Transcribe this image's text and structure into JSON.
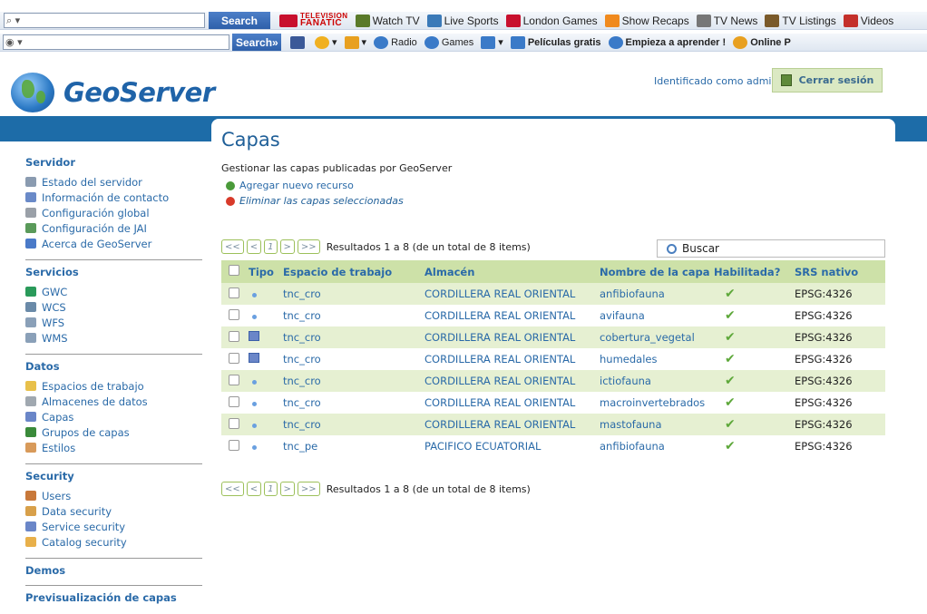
{
  "toolbar1": {
    "search_label": "Search",
    "search_glyph": "⌕ ▾",
    "fanatic_line1": "TELEVISION",
    "fanatic_line2": "FANATIC",
    "items": [
      {
        "label": "Watch TV",
        "icon": "tv-icon",
        "color": "#5a7a2a"
      },
      {
        "label": "Live Sports",
        "icon": "sports-icon",
        "color": "#3b7ab8"
      },
      {
        "label": "London Games",
        "icon": "uk-flag-icon",
        "color": "#c8102e"
      },
      {
        "label": "Show Recaps",
        "icon": "chat-icon",
        "color": "#f08a1e"
      },
      {
        "label": "TV News",
        "icon": "news-icon",
        "color": "#777777"
      },
      {
        "label": "TV Listings",
        "icon": "listings-icon",
        "color": "#7a5a2a"
      },
      {
        "label": "Videos",
        "icon": "youtube-icon",
        "color": "#c4302b"
      }
    ]
  },
  "toolbar2": {
    "search_glyph": "◉ ▾",
    "search_label": "Search»",
    "items": [
      {
        "label": "",
        "icon": "facebook-icon",
        "color": "#3b5998",
        "bold": false
      },
      {
        "label": "▾",
        "icon": "star-icon",
        "color": "#f0b020",
        "bold": false
      },
      {
        "label": "▾",
        "icon": "people-icon",
        "color": "#e8a020",
        "bold": false
      },
      {
        "label": "Radio",
        "icon": "radio-icon",
        "color": "#3a7ac8",
        "bold": false
      },
      {
        "label": "Games",
        "icon": "games-icon",
        "color": "#3a7ac8",
        "bold": false
      },
      {
        "label": "▾",
        "icon": "calendar-icon",
        "color": "#3a7ac8",
        "bold": false
      },
      {
        "label": "Películas gratis",
        "icon": "tv-blue-icon",
        "color": "#3a7ac8",
        "bold": true
      },
      {
        "label": "Empieza a aprender !",
        "icon": "globe-icon",
        "color": "#3a7ac8",
        "bold": true
      },
      {
        "label": "Online P",
        "icon": "smiley-icon",
        "color": "#e8a020",
        "bold": true
      }
    ]
  },
  "header": {
    "logo_text": "GeoServer",
    "identified_as": "Identificado como admin.",
    "logout_label": "Cerrar sesión"
  },
  "sidebar": {
    "sections": [
      {
        "title": "Servidor",
        "items": [
          {
            "label": "Estado del servidor",
            "color": "#8a9bb0"
          },
          {
            "label": "Información de contacto",
            "color": "#6a8ac8"
          },
          {
            "label": "Configuración global",
            "color": "#9aa0a8"
          },
          {
            "label": "Configuración de JAI",
            "color": "#5a9a5a"
          },
          {
            "label": "Acerca de GeoServer",
            "color": "#4a7ac8"
          }
        ]
      },
      {
        "title": "Servicios",
        "items": [
          {
            "label": "GWC",
            "color": "#2a9a5a"
          },
          {
            "label": "WCS",
            "color": "#6a8aa8"
          },
          {
            "label": "WFS",
            "color": "#8aa0b8"
          },
          {
            "label": "WMS",
            "color": "#8aa0b8"
          }
        ]
      },
      {
        "title": "Datos",
        "items": [
          {
            "label": "Espacios de trabajo",
            "color": "#e8c04a"
          },
          {
            "label": "Almacenes de datos",
            "color": "#a0a8b0"
          },
          {
            "label": "Capas",
            "color": "#6a86c8"
          },
          {
            "label": "Grupos de capas",
            "color": "#3a8a3a"
          },
          {
            "label": "Estilos",
            "color": "#d89a5a"
          }
        ]
      },
      {
        "title": "Security",
        "items": [
          {
            "label": "Users",
            "color": "#c8783a"
          },
          {
            "label": "Data security",
            "color": "#d8a04a"
          },
          {
            "label": "Service security",
            "color": "#6a86c8"
          },
          {
            "label": "Catalog security",
            "color": "#e8b04a"
          }
        ]
      },
      {
        "title": "Demos",
        "items": []
      },
      {
        "title": "Previsualización de capas",
        "items": []
      }
    ]
  },
  "page": {
    "title": "Capas",
    "description": "Gestionar las capas publicadas por GeoServer",
    "add_label": "Agregar nuevo recurso",
    "remove_label": "Eliminar las capas seleccionadas",
    "pager": {
      "first": "<<",
      "prev": "<",
      "page": "1",
      "next": ">",
      "last": ">>"
    },
    "results_text": "Resultados 1 a 8 (de un total de 8 items)",
    "search_placeholder": "Buscar"
  },
  "table": {
    "headers": [
      "Tipo",
      "Espacio de trabajo",
      "Almacén",
      "Nombre de la capa",
      "Habilitada?",
      "SRS nativo"
    ],
    "rows": [
      {
        "type": "point",
        "workspace": "tnc_cro",
        "store": "CORDILLERA REAL ORIENTAL",
        "name": "anfibiofauna",
        "enabled": "✔",
        "srs": "EPSG:4326"
      },
      {
        "type": "point",
        "workspace": "tnc_cro",
        "store": "CORDILLERA REAL ORIENTAL",
        "name": "avifauna",
        "enabled": "✔",
        "srs": "EPSG:4326"
      },
      {
        "type": "polygon",
        "workspace": "tnc_cro",
        "store": "CORDILLERA REAL ORIENTAL",
        "name": "cobertura_vegetal",
        "enabled": "✔",
        "srs": "EPSG:4326"
      },
      {
        "type": "polygon",
        "workspace": "tnc_cro",
        "store": "CORDILLERA REAL ORIENTAL",
        "name": "humedales",
        "enabled": "✔",
        "srs": "EPSG:4326"
      },
      {
        "type": "point",
        "workspace": "tnc_cro",
        "store": "CORDILLERA REAL ORIENTAL",
        "name": "ictiofauna",
        "enabled": "✔",
        "srs": "EPSG:4326"
      },
      {
        "type": "point",
        "workspace": "tnc_cro",
        "store": "CORDILLERA REAL ORIENTAL",
        "name": "macroinvertebrados",
        "enabled": "✔",
        "srs": "EPSG:4326"
      },
      {
        "type": "point",
        "workspace": "tnc_cro",
        "store": "CORDILLERA REAL ORIENTAL",
        "name": "mastofauna",
        "enabled": "✔",
        "srs": "EPSG:4326"
      },
      {
        "type": "point",
        "workspace": "tnc_pe",
        "store": "PACIFICO ECUATORIAL",
        "name": "anfibiofauna",
        "enabled": "✔",
        "srs": "EPSG:4326"
      }
    ]
  }
}
